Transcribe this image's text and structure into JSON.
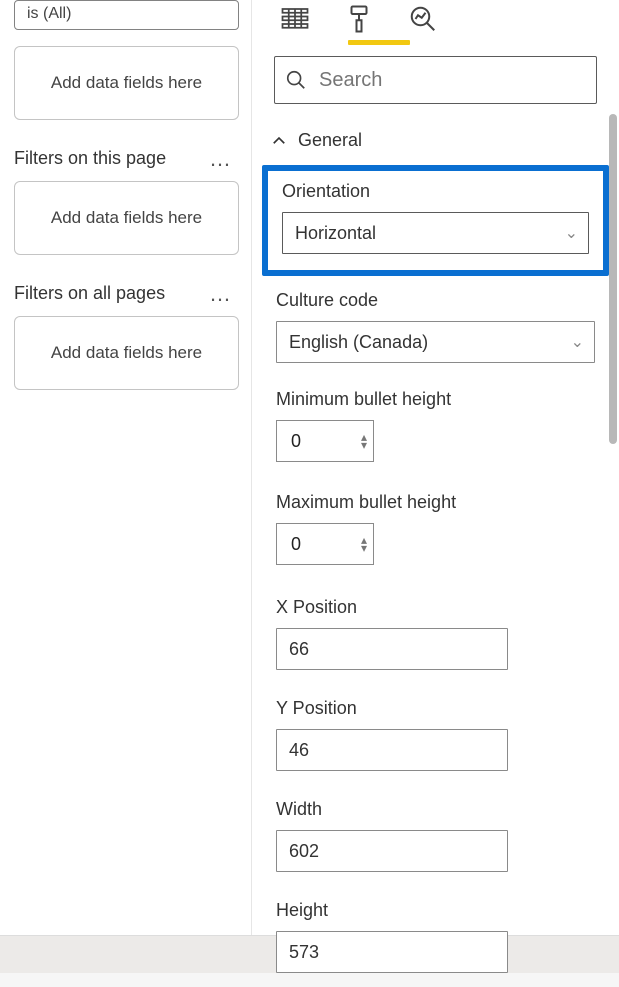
{
  "filters": {
    "existing_text": "is (All)",
    "add_placeholder": "Add data fields here",
    "section_page": "Filters on this page",
    "section_all": "Filters on all pages"
  },
  "search": {
    "placeholder": "Search"
  },
  "section": {
    "general": "General"
  },
  "props": {
    "orientation": {
      "label": "Orientation",
      "value": "Horizontal"
    },
    "culture": {
      "label": "Culture code",
      "value": "English (Canada)"
    },
    "min_bullet": {
      "label": "Minimum bullet height",
      "value": "0"
    },
    "max_bullet": {
      "label": "Maximum bullet height",
      "value": "0"
    },
    "x_pos": {
      "label": "X Position",
      "value": "66"
    },
    "y_pos": {
      "label": "Y Position",
      "value": "46"
    },
    "width": {
      "label": "Width",
      "value": "602"
    },
    "height": {
      "label": "Height",
      "value": "573"
    }
  }
}
